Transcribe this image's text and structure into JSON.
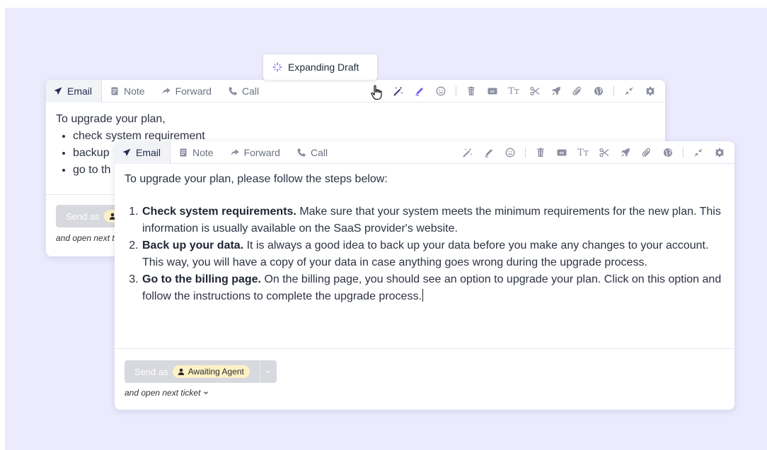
{
  "tooltip": {
    "label": "Expanding Draft"
  },
  "tabs": [
    "Email",
    "Note",
    "Forward",
    "Call"
  ],
  "tools": [
    "magic-wand-icon",
    "pen-icon",
    "smiley-icon",
    "separator",
    "trash-icon",
    "cc-icon",
    "text-size-icon",
    "scissors-icon",
    "rocket-icon",
    "paperclip-icon",
    "globe-icon",
    "separator",
    "collapse-icon",
    "gear-icon"
  ],
  "tool_glyphs": {
    "cc": "cc",
    "text_size": "Tт"
  },
  "back_editor": {
    "intro": "To upgrade your plan,",
    "items": [
      "check system requirement",
      "backup",
      "go to th"
    ]
  },
  "front_editor": {
    "intro": "To upgrade your plan, please follow the steps below:",
    "steps": [
      {
        "title": "Check system requirements.",
        "text": " Make sure that your system meets the minimum requirements for the new plan. This information is usually available on the SaaS provider's website."
      },
      {
        "title": "Back up your data.",
        "text": " It is always a good idea to back up your data before you make any changes to your account. This way, you will have a copy of your data in case anything goes wrong during the upgrade process."
      },
      {
        "title": "Go to the billing page.",
        "text": " On the billing page, you should see an option to upgrade your plan. Click on this option and follow the instructions to complete the upgrade process."
      }
    ]
  },
  "footer": {
    "send_label": "Send as",
    "status": "Awaiting Agent",
    "open_next": "and open next ticket",
    "back_send_label": "Send as",
    "back_open_next": "and open next t"
  },
  "colors": {
    "canvas": "#ecebfd",
    "accent": "#7b5cf0",
    "badge_bg": "#fdf1c5",
    "button_disabled": "#d8d9de"
  }
}
